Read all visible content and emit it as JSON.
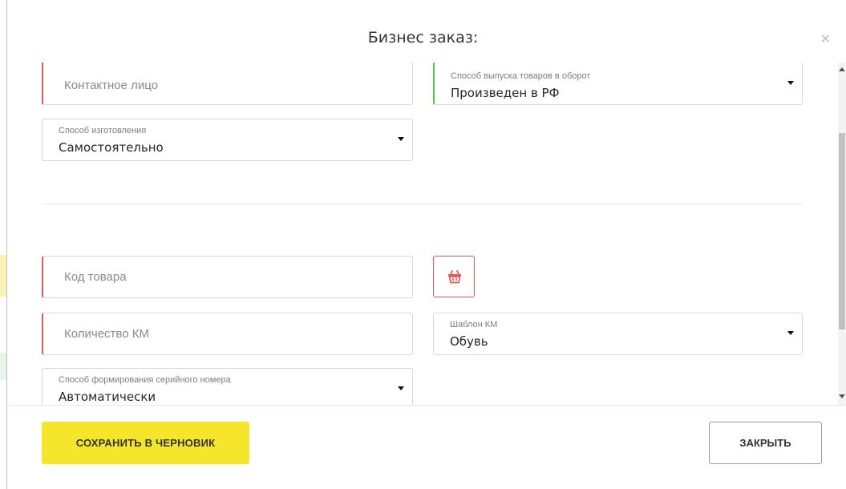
{
  "modal": {
    "title": "Бизнес заказ:",
    "close_glyph": "×"
  },
  "form": {
    "contact_person": {
      "placeholder": "Контактное лицо"
    },
    "release_method": {
      "label": "Способ выпуска товаров в оборот",
      "value": "Произведен в РФ"
    },
    "manufacture_method": {
      "label": "Способ изготовления",
      "value": "Самостоятельно"
    },
    "product_code": {
      "placeholder": "Код товара"
    },
    "km_quantity": {
      "placeholder": "Количество КМ"
    },
    "km_template": {
      "label": "Шаблон КМ",
      "value": "Обувь"
    },
    "serial_method": {
      "label": "Способ формирования серийного номера",
      "value": "Автоматически"
    }
  },
  "footer": {
    "save_label": "СОХРАНИТЬ В ЧЕРНОВИК",
    "close_label": "ЗАКРЫТЬ"
  },
  "colors": {
    "accent_yellow": "#f5e62b",
    "required_red": "#e05a5a",
    "valid_green": "#59c05a"
  },
  "icons": {
    "delete": "trash-basket-icon",
    "dropdown": "caret-down-icon",
    "close": "close-icon"
  }
}
